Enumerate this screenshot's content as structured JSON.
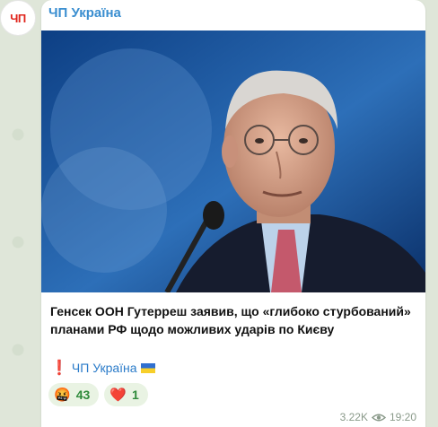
{
  "avatar": {
    "text": "ЧП"
  },
  "post": {
    "channel_name": "ЧП Україна",
    "text": "Генсек ООН Гутерреш заявив, що «глибоко стурбований» планами РФ щодо можливих ударів по Києву",
    "signature": {
      "mark": "❗",
      "name": "ЧП Україна",
      "flag_icon": "ukraine-flag-icon"
    },
    "reactions": [
      {
        "emoji": "🤬",
        "count": "43"
      },
      {
        "emoji": "❤️",
        "count": "1"
      }
    ],
    "views": "3.22K",
    "time": "19:20"
  },
  "colors": {
    "accent": "#3a8ed0",
    "reaction_bg": "#e9f3e3",
    "reaction_text": "#2e8a3a"
  }
}
